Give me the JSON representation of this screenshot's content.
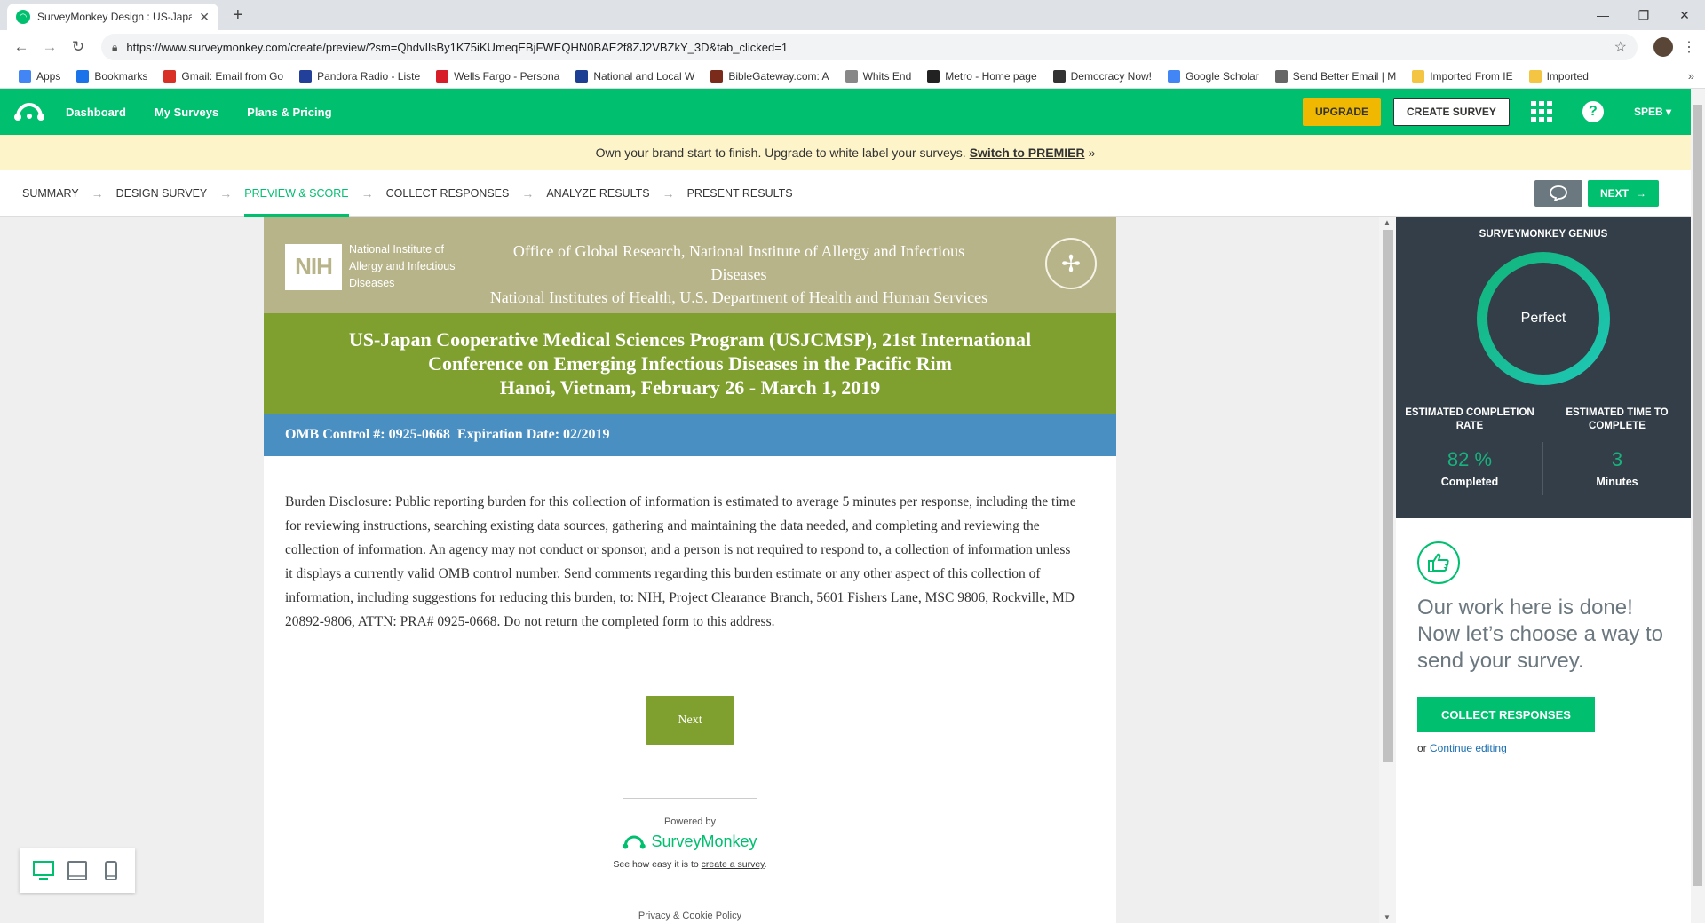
{
  "browser": {
    "tab_title": "SurveyMonkey Design : US-Japan",
    "url": "https://www.surveymonkey.com/create/preview/?sm=QhdvIlsBy1K75iKUmeqEBjFWEQHN0BAE2f8ZJ2VBZkY_3D&tab_clicked=1",
    "bookmarks": [
      {
        "label": "Apps",
        "color": "#4285f4"
      },
      {
        "label": "Bookmarks",
        "color": "#1a73e8"
      },
      {
        "label": "Gmail: Email from Go",
        "color": "#d93025"
      },
      {
        "label": "Pandora Radio - Liste",
        "color": "#224099"
      },
      {
        "label": "Wells Fargo - Persona",
        "color": "#d71e28"
      },
      {
        "label": "National and Local W",
        "color": "#1c3f94"
      },
      {
        "label": "BibleGateway.com: A",
        "color": "#7a2b1a"
      },
      {
        "label": "Whits End",
        "color": "#888888"
      },
      {
        "label": "Metro - Home page",
        "color": "#222222"
      },
      {
        "label": "Democracy Now!",
        "color": "#333333"
      },
      {
        "label": "Google Scholar",
        "color": "#4285f4"
      },
      {
        "label": "Send Better Email | M",
        "color": "#666666"
      },
      {
        "label": "Imported From IE",
        "color": "#f4c542"
      },
      {
        "label": "Imported",
        "color": "#f4c542"
      }
    ],
    "bookmarks_more": "»"
  },
  "header": {
    "nav": [
      "Dashboard",
      "My Surveys",
      "Plans & Pricing"
    ],
    "upgrade": "UPGRADE",
    "create": "CREATE SURVEY",
    "help": "?",
    "user": "SPEB"
  },
  "promo": {
    "text": "Own your brand start to finish. Upgrade to white label your surveys.",
    "link": "Switch to PREMIER",
    "link_suffix": "»"
  },
  "steps": {
    "items": [
      "SUMMARY",
      "DESIGN SURVEY",
      "PREVIEW & SCORE",
      "COLLECT RESPONSES",
      "ANALYZE RESULTS",
      "PRESENT RESULTS"
    ],
    "active_index": 2,
    "next": "NEXT"
  },
  "survey": {
    "nih_logo": "NIH",
    "nih_text": "National Institute of Allergy and Infectious Diseases",
    "office_line1": "Office of Global Research, National Institute of Allergy and Infectious Diseases",
    "office_line2": "National Institutes of Health, U.S. Department of Health and Human Services",
    "title_line1": "US-Japan Cooperative Medical Sciences Program (USJCMSP), 21st International",
    "title_line2": "Conference on Emerging Infectious Diseases in the Pacific Rim",
    "title_line3": "Hanoi, Vietnam, February 26 - March 1, 2019",
    "omb": "OMB Control #: 0925-0668  Expiration Date: 02/2019",
    "burden": "Burden Disclosure: Public reporting burden for this collection of information is estimated to average 5 minutes per response, including the time for reviewing instructions, searching existing data sources, gathering and maintaining the data needed, and completing and reviewing the collection of information. An agency may not conduct or sponsor, and a person is not required to respond to, a collection of information unless it displays a currently valid OMB control number. Send comments regarding this burden estimate or any other aspect of this collection of information, including suggestions for reducing this burden, to:  NIH, Project Clearance Branch, 5601 Fishers Lane, MSC 9806, Rockville, MD 20892-9806, ATTN: PRA# 0925-0668. Do not return the completed form to this address.",
    "next": "Next",
    "powered_by": "Powered by",
    "brand": "SurveyMonkey",
    "see_how_prefix": "See how easy it is to",
    "see_how_link": "create a survey",
    "see_how_suffix": ".",
    "privacy": "Privacy & Cookie Policy"
  },
  "genius": {
    "title": "SURVEYMONKEY GENIUS",
    "score": "Perfect",
    "completion_label": "ESTIMATED COMPLETION RATE",
    "completion_value": "82 %",
    "completion_sub": "Completed",
    "time_label": "ESTIMATED TIME TO COMPLETE",
    "time_value": "3",
    "time_sub": "Minutes",
    "accent": "#19b27e"
  },
  "done": {
    "message": "Our work here is done! Now let’s choose a way to send your survey.",
    "collect": "COLLECT RESPONSES",
    "or": "or",
    "continue": "Continue editing"
  }
}
